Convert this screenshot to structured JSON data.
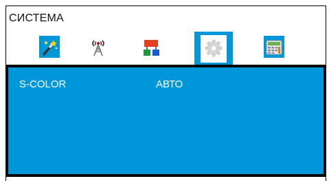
{
  "menu": {
    "title": "СИСТЕМА"
  },
  "tabs": [
    {
      "icon": "magic-wand-icon",
      "active": false
    },
    {
      "icon": "antenna-tower-icon",
      "active": false
    },
    {
      "icon": "input-blocks-icon",
      "active": false
    },
    {
      "icon": "gear-icon",
      "active": true
    },
    {
      "icon": "calculator-icon",
      "active": false
    }
  ],
  "settings": [
    {
      "label": "S-COLOR",
      "value": "АВТО"
    }
  ],
  "colors": {
    "panel": "#0096da",
    "border": "#000000",
    "text": "#ffffff"
  }
}
